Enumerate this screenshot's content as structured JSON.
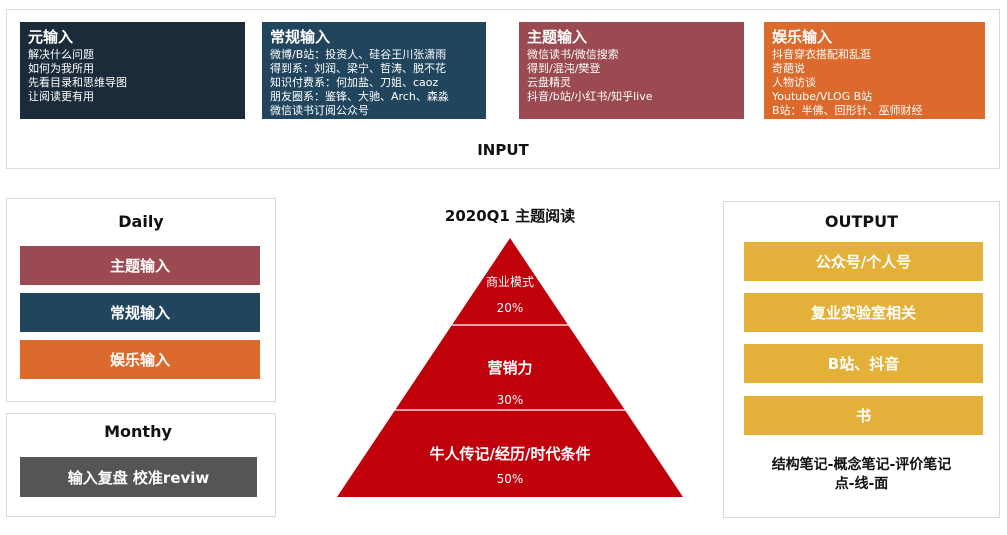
{
  "input": {
    "label": "INPUT",
    "cards": [
      {
        "title": "元输入",
        "color": "#1c2b39",
        "lines": [
          "解决什么问题",
          "如何为我所用",
          "先看目录和思维导图",
          "让阅读更有用"
        ]
      },
      {
        "title": "常规输入",
        "color": "#22455e",
        "lines": [
          "微博/B站：投资人、硅谷王川张潇雨",
          "得到系：刘润、梁宁、哲涛、脱不花",
          "知识付费系：何加盐、刀姐、caoz",
          "朋友圈系：鉴锋、大驰、Arch、森淼",
          "微信读书订阅公众号"
        ]
      },
      {
        "title": "主题输入",
        "color": "#9a4a50",
        "lines": [
          "微信读书/微信搜索",
          "得到/混沌/樊登",
          "云盘精灵",
          "抖音/b站/小红书/知乎live"
        ]
      },
      {
        "title": "娱乐输入",
        "color": "#dd6a2d",
        "lines": [
          "抖音穿衣搭配和乱逛",
          "奇葩说",
          "人物访谈",
          "Youtube/VLOG B站",
          "B站：半佛、回形针、巫师财经"
        ]
      }
    ]
  },
  "daily": {
    "title": "Daily",
    "items": [
      {
        "label": "主题输入",
        "color": "#9a4a50"
      },
      {
        "label": "常规输入",
        "color": "#22455e"
      },
      {
        "label": "娱乐输入",
        "color": "#dd6a2d"
      }
    ]
  },
  "monthly": {
    "title": "Monthy",
    "item": {
      "label": "输入复盘 校准reviw",
      "color": "#555555"
    }
  },
  "pyramid": {
    "title": "2020Q1 主题阅读",
    "color": "#c0000b",
    "levels": [
      {
        "label": "商业模式",
        "percent": "20%"
      },
      {
        "label": "营销力",
        "percent": "30%"
      },
      {
        "label": "牛人传记/经历/时代条件",
        "percent": "50%"
      }
    ]
  },
  "output": {
    "title": "OUTPUT",
    "items": [
      "公众号/个人号",
      "复业实验室相关",
      "B站、抖音",
      "书"
    ],
    "footer_line1": "结构笔记-概念笔记-评价笔记",
    "footer_line2": "点-线-面"
  }
}
